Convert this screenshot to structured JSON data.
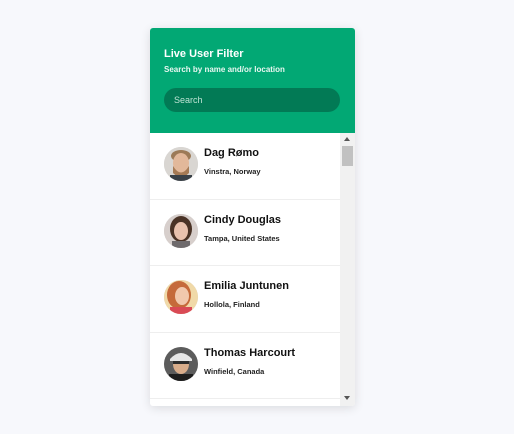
{
  "header": {
    "title": "Live User Filter",
    "subtitle": "Search by name and/or location",
    "search_placeholder": "Search"
  },
  "users": [
    {
      "name": "Dag Rømo",
      "location": "Vinstra, Norway",
      "avatar": "avatar-male-blond"
    },
    {
      "name": "Cindy Douglas",
      "location": "Tampa, United States",
      "avatar": "avatar-female-brunette"
    },
    {
      "name": "Emilia Juntunen",
      "location": "Hollola, Finland",
      "avatar": "avatar-female-red"
    },
    {
      "name": "Thomas Harcourt",
      "location": "Winfield, Canada",
      "avatar": "avatar-male-cap"
    }
  ],
  "colors": {
    "accent": "#02a874",
    "search_bg": "#027a55"
  }
}
